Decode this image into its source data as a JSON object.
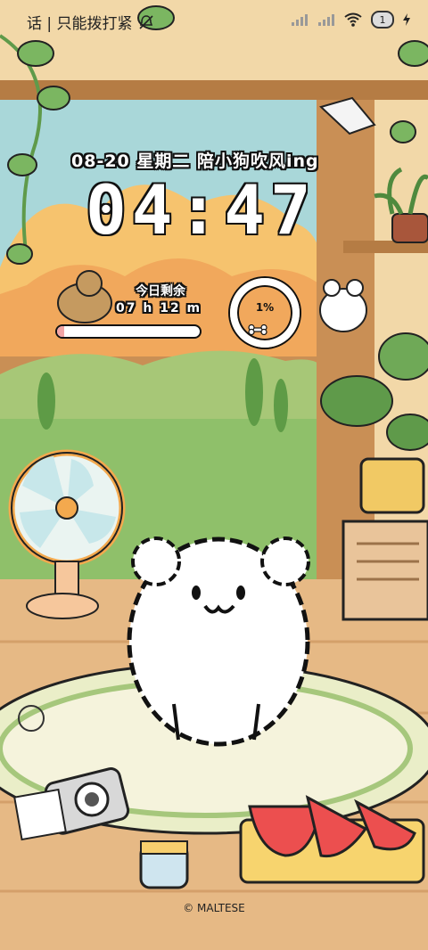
{
  "status_bar": {
    "carrier_text": "话 | 只能拨打紧",
    "sim_badge": "1",
    "icons": [
      "mute-icon",
      "signal-icon",
      "signal-icon",
      "wifi-icon",
      "battery-icon",
      "charging-icon"
    ]
  },
  "lockscreen": {
    "date_line": "08-20 星期二  陪小狗吹风ing",
    "time": "04:47"
  },
  "widget": {
    "label": "今日剩余",
    "remaining": "07 h 12 m",
    "progress": 0.05,
    "ring_text": "1%",
    "ring_fraction": 0.01
  },
  "footer": {
    "copyright": "© MALTESE"
  },
  "colors": {
    "sky": "#a9d7d9",
    "hills": "#8fc06a",
    "floor": "#e6b985",
    "wood": "#c98f55",
    "sunset": "#f6c36e"
  }
}
